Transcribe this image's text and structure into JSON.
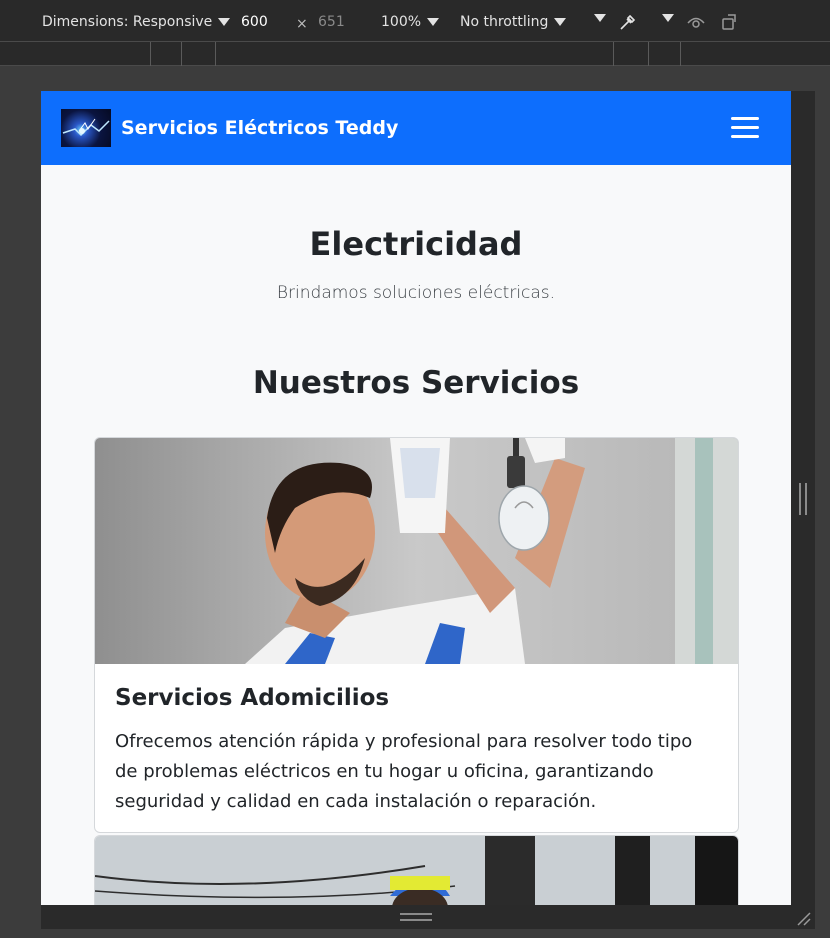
{
  "devtools": {
    "dimensions_label": "Dimensions: Responsive",
    "width_value": "600",
    "times_symbol": "×",
    "height_value": "651",
    "zoom_label": "100%",
    "throttling_label": "No throttling",
    "icons": [
      "dropdown-caret-icon",
      "eyedropper-icon",
      "eye-icon",
      "rotate-device-icon"
    ]
  },
  "navbar": {
    "brand": "Servicios Eléctricos Teddy",
    "logo_icon": "lightning-logo-icon",
    "menu_icon": "hamburger-menu-icon",
    "color": "#0d6efd"
  },
  "hero": {
    "title": "Electricidad",
    "subtitle": "Brindamos soluciones eléctricas."
  },
  "services": {
    "title": "Nuestros Servicios",
    "cards": [
      {
        "image_icon": "electrician-lightbulb-photo",
        "title": "Servicios Adomicilios",
        "text": "Ofrecemos atención rápida y profesional para resolver todo tipo de problemas eléctricos en tu hogar u oficina, garantizando seguridad y calidad en cada instalación o reparación."
      },
      {
        "image_icon": "lineman-pole-photo"
      }
    ]
  }
}
